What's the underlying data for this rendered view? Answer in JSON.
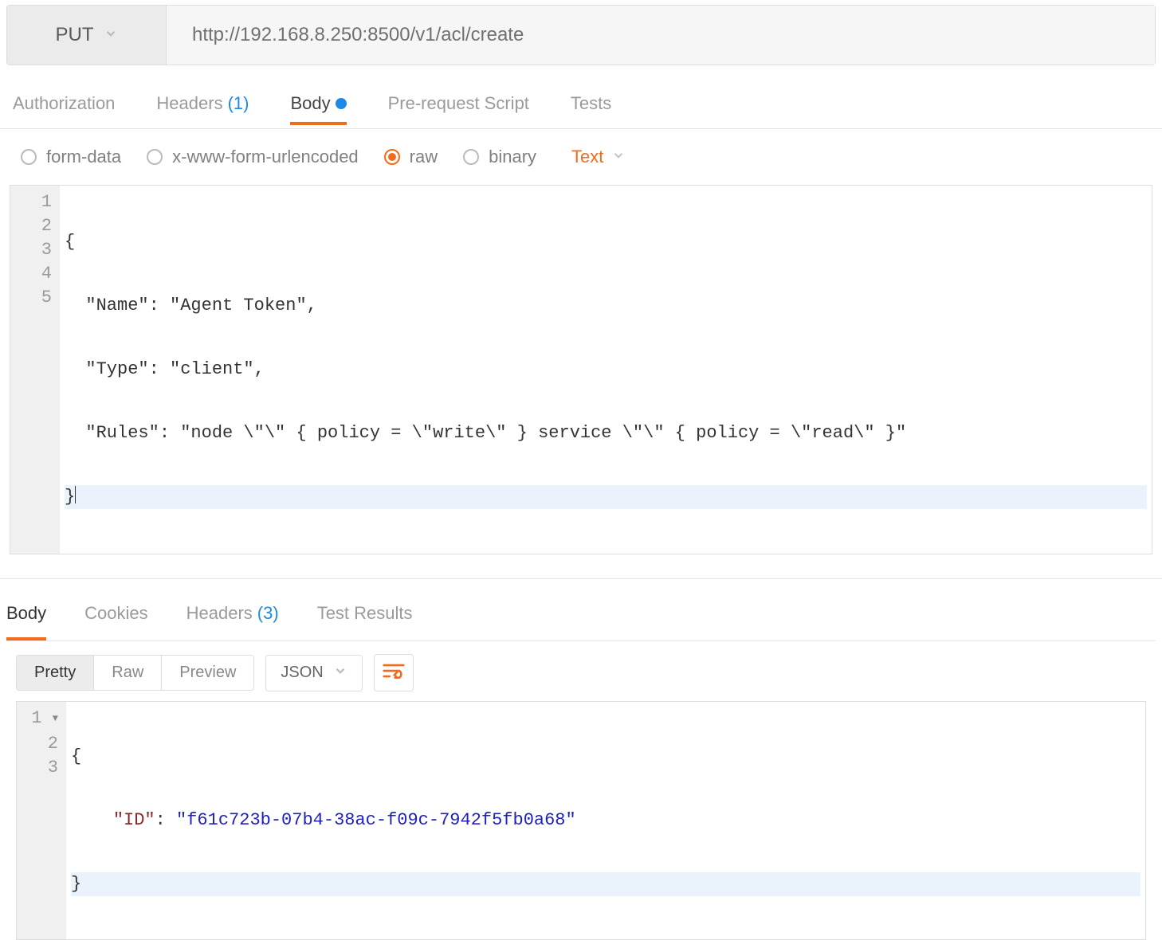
{
  "request": {
    "method_label": "PUT",
    "url": "http://192.168.8.250:8500/v1/acl/create"
  },
  "request_tabs": {
    "authorization": "Authorization",
    "headers_label": "Headers",
    "headers_count": "(1)",
    "body": "Body",
    "pre_request": "Pre-request Script",
    "tests": "Tests"
  },
  "body_types": {
    "form_data": "form-data",
    "urlencoded": "x-www-form-urlencoded",
    "raw": "raw",
    "binary": "binary",
    "text_dropdown": "Text"
  },
  "editor": {
    "lines": [
      "1",
      "2",
      "3",
      "4",
      "5"
    ],
    "l1": "{",
    "l2": "  \"Name\": \"Agent Token\",",
    "l3": "  \"Type\": \"client\",",
    "l4": "  \"Rules\": \"node \\\"\\\" { policy = \\\"write\\\" } service \\\"\\\" { policy = \\\"read\\\" }\"",
    "l5": "}"
  },
  "response_tabs": {
    "body": "Body",
    "cookies": "Cookies",
    "headers_label": "Headers",
    "headers_count": "(3)",
    "test_results": "Test Results"
  },
  "response_toolbar": {
    "pretty": "Pretty",
    "raw": "Raw",
    "preview": "Preview",
    "format": "JSON"
  },
  "response_body": {
    "lines": [
      "1",
      "2",
      "3"
    ],
    "l1": "{",
    "l2_indent": "    ",
    "l2_key": "\"ID\"",
    "l2_sep": ": ",
    "l2_val": "\"f61c723b-07b4-38ac-f09c-7942f5fb0a68\"",
    "l3": "}"
  }
}
